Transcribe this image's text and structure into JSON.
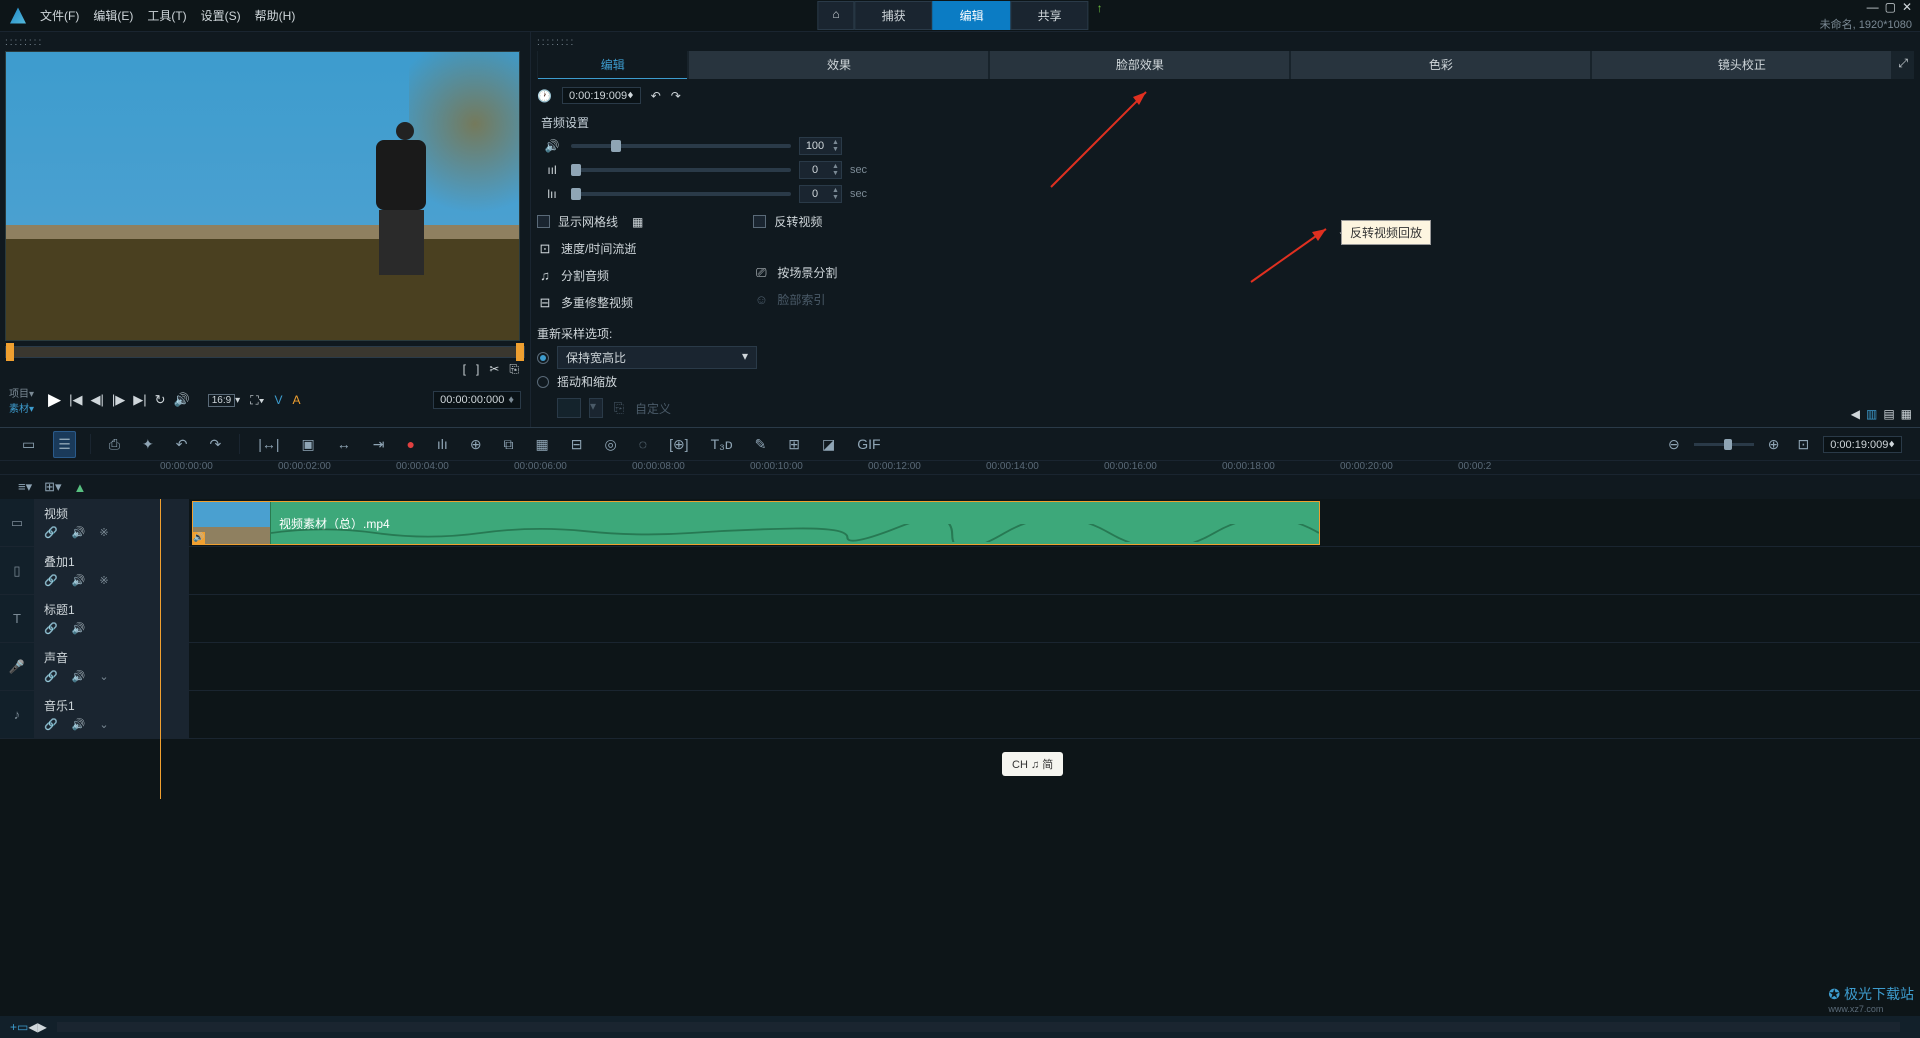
{
  "menubar": {
    "file": "文件(F)",
    "edit": "编辑(E)",
    "tools": "工具(T)",
    "settings": "设置(S)",
    "help": "帮助(H)"
  },
  "center_tabs": {
    "home": "⌂",
    "capture": "捕获",
    "edit": "编辑",
    "share": "共享"
  },
  "meta_text": "未命名, 1920*1080",
  "preview": {
    "proj": "项目▾",
    "material": "素材▾",
    "timecode": "00:00:00:000",
    "aspect": "16:9",
    "v": "V",
    "a": "A"
  },
  "edit_panel": {
    "tabs": {
      "edit": "编辑",
      "fx": "效果",
      "face": "脸部效果",
      "color": "色彩",
      "lens": "镜头校正"
    },
    "timecode": "0:00:19:009",
    "audio_settings": "音频设置",
    "volume": "100",
    "fadein": "0",
    "fadeout": "0",
    "sec": "sec",
    "show_grid": "显示网格线",
    "speed": "速度/时间流逝",
    "split_audio": "分割音频",
    "multi_trim": "多重修整视频",
    "reverse": "反转视频",
    "by_scene": "按场景分割",
    "face_index": "脸部索引",
    "resample": "重新采样选项:",
    "keep_aspect": "保持宽高比",
    "pan_zoom": "摇动和缩放",
    "custom": "自定义",
    "tooltip": "反转视频回放"
  },
  "timeline": {
    "marks": [
      "00:00:00:00",
      "00:00:02:00",
      "00:00:04:00",
      "00:00:06:00",
      "00:00:08:00",
      "00:00:10:00",
      "00:00:12:00",
      "00:00:14:00",
      "00:00:16:00",
      "00:00:18:00",
      "00:00:20:00",
      "00:00:2"
    ],
    "tc_right": "0:00:19:009",
    "tracks": {
      "video": "视频",
      "overlay": "叠加1",
      "title": "标题1",
      "voice": "声音",
      "music": "音乐1"
    },
    "clip_name": "视频素材（总）.mp4"
  },
  "lang": "CH ♫ 简",
  "watermark": {
    "name": "极光下载站",
    "url": "www.xz7.com"
  }
}
